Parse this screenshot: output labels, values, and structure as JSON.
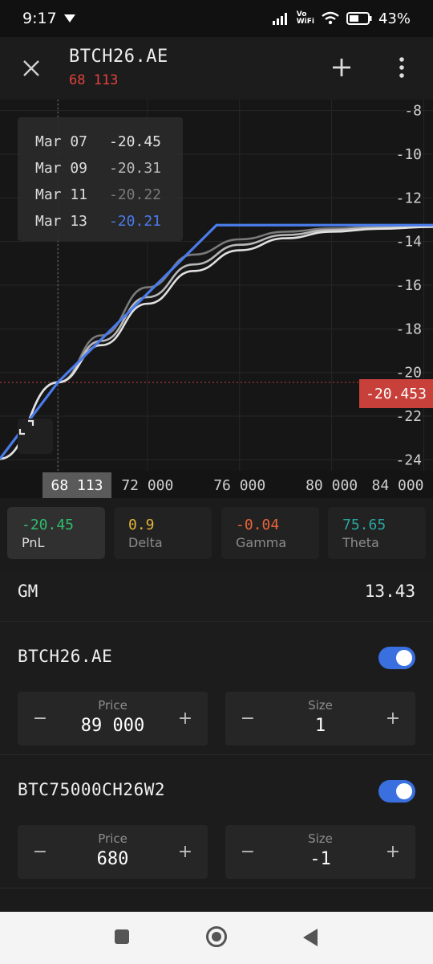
{
  "status": {
    "time": "9:17",
    "volte": "Vo\nWiFi",
    "battery": "43%"
  },
  "header": {
    "title": "BTCH26.AE",
    "price": "68 113"
  },
  "chart_data": {
    "type": "line",
    "x_ticks": [
      "68 113",
      "72 000",
      "76 000",
      "80 000",
      "84 000"
    ],
    "y_ticks": [
      "-8",
      "-10",
      "-12",
      "-14",
      "-16",
      "-18",
      "-20",
      "-22",
      "-24"
    ],
    "xlim": [
      65600,
      84400
    ],
    "ylim": [
      -24.5,
      -7.5
    ],
    "current_x": 68113,
    "current_y": -20.453,
    "current_y_label": "-20.453",
    "expiry_kink": {
      "x": 75000,
      "y": -13.25
    },
    "tooltip": [
      {
        "date": "Mar 07",
        "value": "-20.45",
        "color": "#e0e0e0"
      },
      {
        "date": "Mar 09",
        "value": "-20.31",
        "color": "#b8b8b8"
      },
      {
        "date": "Mar 11",
        "value": "-20.22",
        "color": "#7a7a7a"
      },
      {
        "date": "Mar 13",
        "value": "-20.21",
        "color": "#4a7bea"
      }
    ],
    "series": [
      {
        "color": "#4a7bea",
        "x": [
          65600,
          68113,
          75000,
          84400
        ],
        "y": [
          -23.95,
          -20.45,
          -13.25,
          -13.25
        ]
      },
      {
        "color": "#7a7a7a",
        "x": [
          65600,
          68113,
          70000,
          72000,
          74000,
          76000,
          78000,
          80000,
          82000,
          84400
        ],
        "y": [
          -23.95,
          -20.45,
          -18.3,
          -16.1,
          -14.6,
          -13.9,
          -13.55,
          -13.4,
          -13.32,
          -13.27
        ]
      },
      {
        "color": "#b8b8b8",
        "x": [
          65600,
          68113,
          70000,
          72000,
          74000,
          76000,
          78000,
          80000,
          82000,
          84400
        ],
        "y": [
          -23.95,
          -20.45,
          -18.55,
          -16.55,
          -15.05,
          -14.15,
          -13.7,
          -13.47,
          -13.37,
          -13.3
        ]
      },
      {
        "color": "#e0e0e0",
        "x": [
          65600,
          68113,
          70000,
          72000,
          74000,
          76000,
          78000,
          80000,
          82000,
          84400
        ],
        "y": [
          -23.95,
          -20.45,
          -18.75,
          -16.85,
          -15.35,
          -14.4,
          -13.85,
          -13.55,
          -13.42,
          -13.33
        ]
      }
    ]
  },
  "greeks": [
    {
      "value": "-20.45",
      "label": "PnL",
      "color": "#2ebd6b"
    },
    {
      "value": "0.9",
      "label": "Delta",
      "color": "#e6b53a"
    },
    {
      "value": "-0.04",
      "label": "Gamma",
      "color": "#e8653a"
    },
    {
      "value": "75.65",
      "label": "Theta",
      "color": "#2aa6a0"
    }
  ],
  "gm": {
    "label": "GM",
    "value": "13.43"
  },
  "legs": [
    {
      "name": "BTCH26.AE",
      "price_label": "Price",
      "price": "89 000",
      "size_label": "Size",
      "size": "1",
      "enabled": true
    },
    {
      "name": "BTC75000CH26W2",
      "price_label": "Price",
      "price": "680",
      "size_label": "Size",
      "size": "-1",
      "enabled": true
    }
  ],
  "stepper_minus": "−",
  "stepper_plus": "+",
  "colors": {
    "accent": "#4a7bea",
    "loss": "#e0433b"
  }
}
